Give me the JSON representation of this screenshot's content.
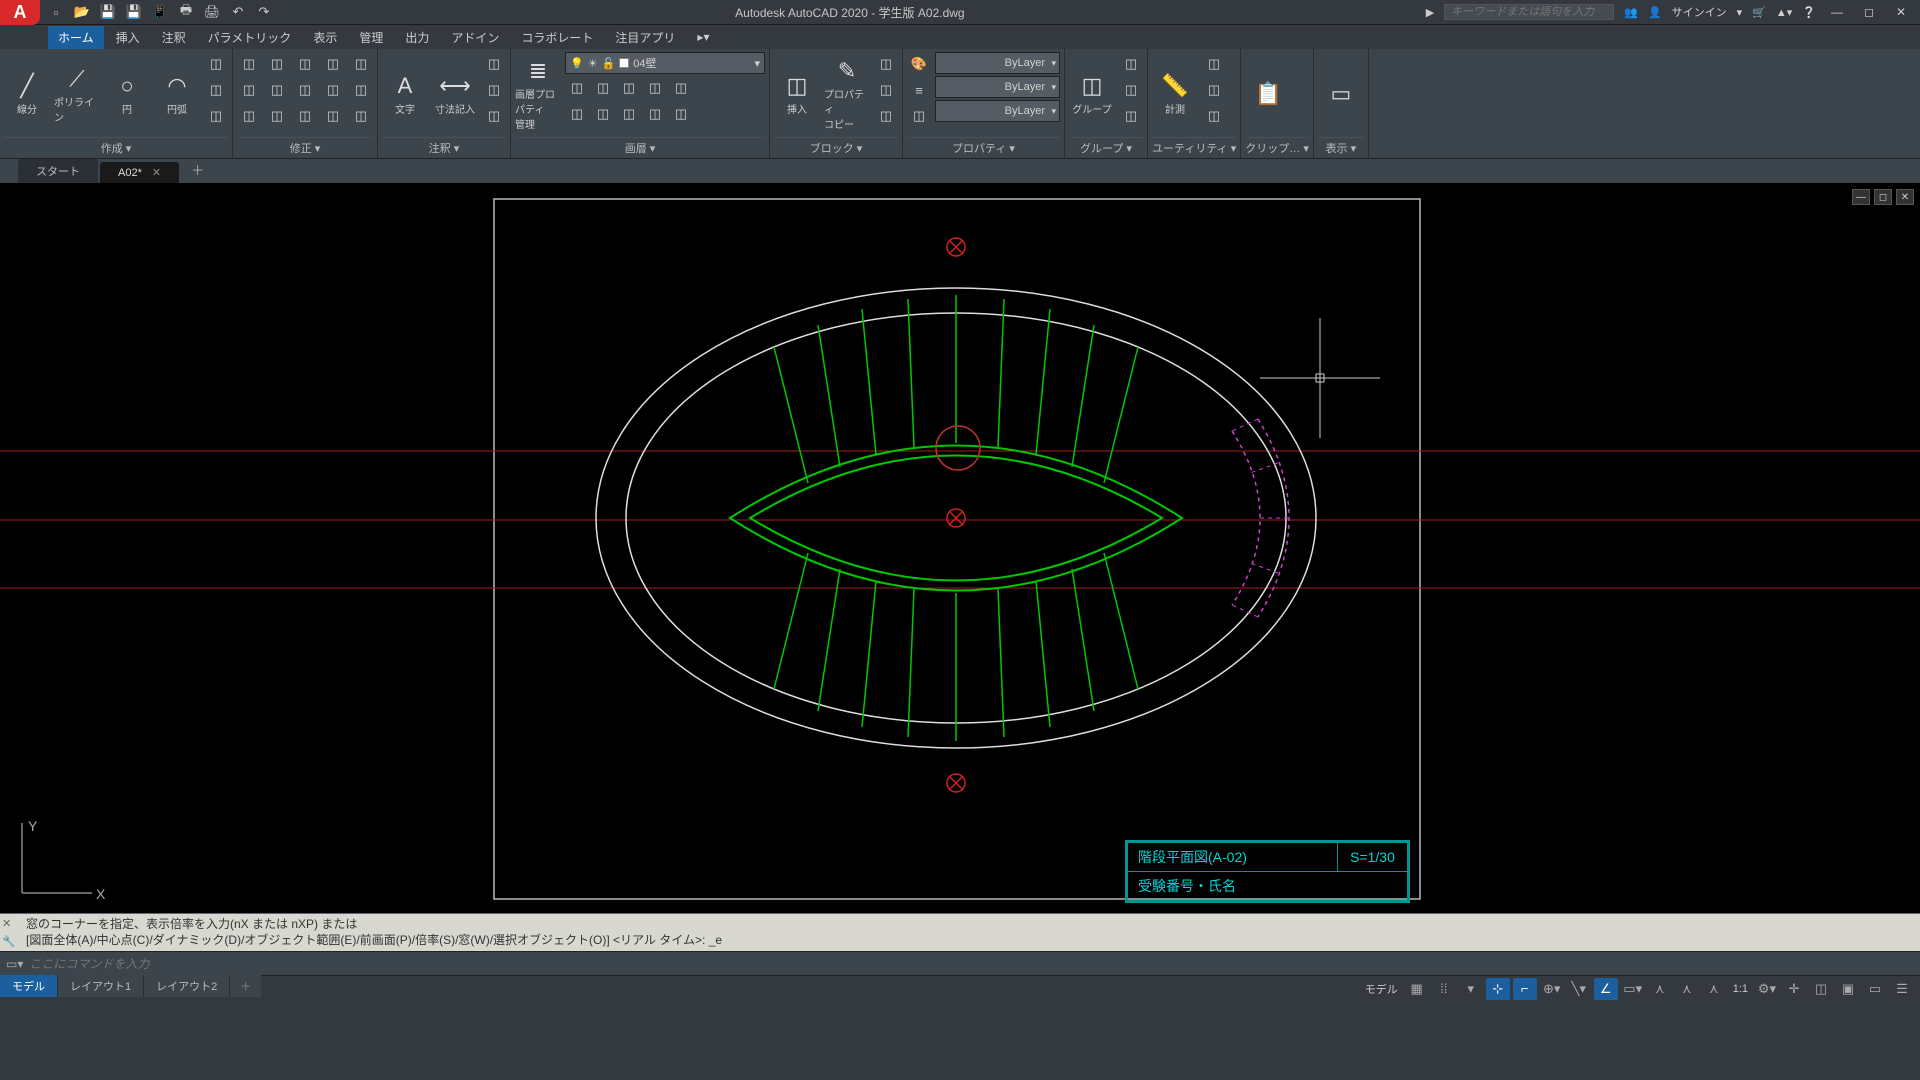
{
  "app": {
    "title": "Autodesk AutoCAD 2020 - 学生版   A02.dwg",
    "logo": "A"
  },
  "search": {
    "placeholder": "キーワードまたは語句を入力"
  },
  "signin": "サインイン",
  "menubar": [
    "ホーム",
    "挿入",
    "注釈",
    "パラメトリック",
    "表示",
    "管理",
    "出力",
    "アドイン",
    "コラボレート",
    "注目アプリ"
  ],
  "menubar_active": 0,
  "ribbon": {
    "panels": [
      {
        "name": "作成",
        "big": [
          {
            "lbl": "線分",
            "ico": "╱"
          },
          {
            "lbl": "ポリライン",
            "ico": "⟋"
          },
          {
            "lbl": "円",
            "ico": "○"
          },
          {
            "lbl": "円弧",
            "ico": "◠"
          }
        ],
        "small_cols": 1
      },
      {
        "name": "修正",
        "small_cols": 5
      },
      {
        "name": "注釈",
        "big": [
          {
            "lbl": "文字",
            "ico": "A"
          },
          {
            "lbl": "寸法記入",
            "ico": "⟷"
          }
        ],
        "small_cols": 1
      },
      {
        "name": "画層",
        "big": [
          {
            "lbl": "画層プロパティ\n管理",
            "ico": "≣"
          }
        ],
        "layer_dd": true,
        "small_cols": 0
      },
      {
        "name": "ブロック",
        "big": [
          {
            "lbl": "挿入",
            "ico": "◫"
          },
          {
            "lbl": "プロパティ\nコピー",
            "ico": "✎"
          }
        ],
        "small_cols": 1
      },
      {
        "name": "プロパティ",
        "prop": true
      },
      {
        "name": "グループ",
        "big": [
          {
            "lbl": "グループ",
            "ico": "◫"
          }
        ],
        "small_cols": 1
      },
      {
        "name": "ユーティリティ",
        "big": [
          {
            "lbl": "計測",
            "ico": "📏"
          }
        ],
        "small_cols": 1
      },
      {
        "name": "クリップ…",
        "big": [
          {
            "lbl": "",
            "ico": "📋"
          }
        ]
      },
      {
        "name": "表示",
        "big": [
          {
            "lbl": "",
            "ico": "▭"
          }
        ]
      }
    ],
    "layer_current": "04壁",
    "prop": {
      "color": "ByLayer",
      "lw": "ByLayer",
      "lt": "ByLayer"
    }
  },
  "filetabs": [
    {
      "label": "スタート",
      "active": false,
      "closeable": false
    },
    {
      "label": "A02*",
      "active": true,
      "closeable": true
    }
  ],
  "titleblock": {
    "r1c1": "階段平面図(A-02)",
    "r1c2": "S=1/30",
    "r2c1": "受験番号・氏名"
  },
  "ucs": {
    "y": "Y",
    "x": "X"
  },
  "cmd": {
    "hist1": "窓のコーナーを指定、表示倍率を入力(nX または nXP) または",
    "hist2": "[図面全体(A)/中心点(C)/ダイナミック(D)/オブジェクト範囲(E)/前画面(P)/倍率(S)/窓(W)/選択オブジェクト(O)] <リアル タイム>: _e",
    "placeholder": "ここにコマンドを入力"
  },
  "bottomtabs": [
    "モデル",
    "レイアウト1",
    "レイアウト2"
  ],
  "bottomtab_active": 0,
  "status": {
    "space": "モデル",
    "scale": "1:1",
    "buttons": [
      "grid",
      "snap",
      "dyn",
      "ortho",
      "polar",
      "osnap",
      "3dosnap",
      "otrack",
      "lwt",
      "transp",
      "cycle",
      "anno1",
      "anno2",
      "anno3",
      "ws",
      "gear",
      "plus",
      "iso",
      "hw",
      "clean",
      "menu"
    ]
  }
}
